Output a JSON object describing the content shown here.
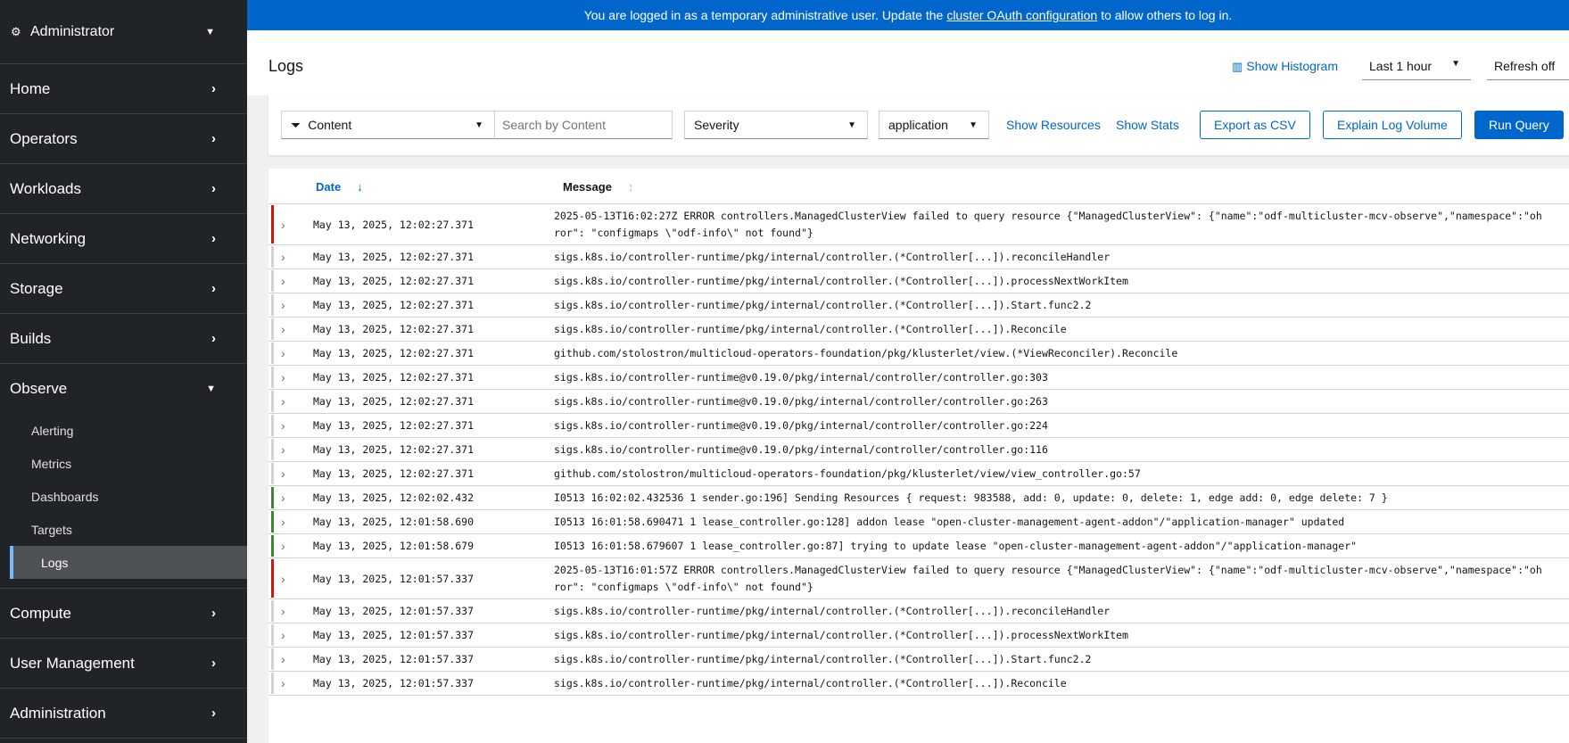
{
  "sidebar": {
    "perspective": "Administrator",
    "items": [
      {
        "label": "Home"
      },
      {
        "label": "Operators"
      },
      {
        "label": "Workloads"
      },
      {
        "label": "Networking"
      },
      {
        "label": "Storage"
      },
      {
        "label": "Builds"
      },
      {
        "label": "Observe"
      },
      {
        "label": "Compute"
      },
      {
        "label": "User Management"
      },
      {
        "label": "Administration"
      }
    ],
    "observe_sub": [
      "Alerting",
      "Metrics",
      "Dashboards",
      "Targets",
      "Logs"
    ]
  },
  "banner": {
    "before": "You are logged in as a temporary administrative user. Update the",
    "link": "cluster OAuth configuration",
    "after": "to allow others to log in."
  },
  "header": {
    "title": "Logs",
    "histogram": "Show Histogram",
    "time_range": "Last 1 hour",
    "refresh": "Refresh off"
  },
  "toolbar": {
    "attribute": "Content",
    "search_placeholder": "Search by Content",
    "severity": "Severity",
    "tenant": "application",
    "show_resources": "Show Resources",
    "show_stats": "Show Stats",
    "export": "Export as CSV",
    "explain": "Explain Log Volume",
    "run": "Run Query"
  },
  "table": {
    "col_date": "Date",
    "col_message": "Message",
    "severity_colors": {
      "error": "#c9190b",
      "info": "#3e8635",
      "none": "#d2d2d2"
    },
    "rows": [
      {
        "date": "May 13, 2025, 12:02:27.371",
        "sev": "error",
        "msg": "2025-05-13T16:02:27Z ERROR controllers.ManagedClusterView failed to query resource {\"ManagedClusterView\": {\"name\":\"odf-multicluster-mcv-observe\",\"namespace\":\"oh\nror\": \"configmaps \\\"odf-info\\\" not found\"}"
      },
      {
        "date": "May 13, 2025, 12:02:27.371",
        "sev": "none",
        "msg": "sigs.k8s.io/controller-runtime/pkg/internal/controller.(*Controller[...]).reconcileHandler"
      },
      {
        "date": "May 13, 2025, 12:02:27.371",
        "sev": "none",
        "msg": "sigs.k8s.io/controller-runtime/pkg/internal/controller.(*Controller[...]).processNextWorkItem"
      },
      {
        "date": "May 13, 2025, 12:02:27.371",
        "sev": "none",
        "msg": "sigs.k8s.io/controller-runtime/pkg/internal/controller.(*Controller[...]).Start.func2.2"
      },
      {
        "date": "May 13, 2025, 12:02:27.371",
        "sev": "none",
        "msg": "sigs.k8s.io/controller-runtime/pkg/internal/controller.(*Controller[...]).Reconcile"
      },
      {
        "date": "May 13, 2025, 12:02:27.371",
        "sev": "none",
        "msg": "github.com/stolostron/multicloud-operators-foundation/pkg/klusterlet/view.(*ViewReconciler).Reconcile"
      },
      {
        "date": "May 13, 2025, 12:02:27.371",
        "sev": "none",
        "msg": "sigs.k8s.io/controller-runtime@v0.19.0/pkg/internal/controller/controller.go:303"
      },
      {
        "date": "May 13, 2025, 12:02:27.371",
        "sev": "none",
        "msg": "sigs.k8s.io/controller-runtime@v0.19.0/pkg/internal/controller/controller.go:263"
      },
      {
        "date": "May 13, 2025, 12:02:27.371",
        "sev": "none",
        "msg": "sigs.k8s.io/controller-runtime@v0.19.0/pkg/internal/controller/controller.go:224"
      },
      {
        "date": "May 13, 2025, 12:02:27.371",
        "sev": "none",
        "msg": "sigs.k8s.io/controller-runtime@v0.19.0/pkg/internal/controller/controller.go:116"
      },
      {
        "date": "May 13, 2025, 12:02:27.371",
        "sev": "none",
        "msg": "github.com/stolostron/multicloud-operators-foundation/pkg/klusterlet/view/view_controller.go:57"
      },
      {
        "date": "May 13, 2025, 12:02:02.432",
        "sev": "info",
        "msg": "I0513 16:02:02.432536 1 sender.go:196] Sending Resources { request: 983588, add: 0, update: 0, delete: 1, edge add: 0, edge delete: 7 }"
      },
      {
        "date": "May 13, 2025, 12:01:58.690",
        "sev": "info",
        "msg": "I0513 16:01:58.690471 1 lease_controller.go:128] addon lease \"open-cluster-management-agent-addon\"/\"application-manager\" updated"
      },
      {
        "date": "May 13, 2025, 12:01:58.679",
        "sev": "info",
        "msg": "I0513 16:01:58.679607 1 lease_controller.go:87] trying to update lease \"open-cluster-management-agent-addon\"/\"application-manager\""
      },
      {
        "date": "May 13, 2025, 12:01:57.337",
        "sev": "error",
        "msg": "2025-05-13T16:01:57Z ERROR controllers.ManagedClusterView failed to query resource {\"ManagedClusterView\": {\"name\":\"odf-multicluster-mcv-observe\",\"namespace\":\"oh\nror\": \"configmaps \\\"odf-info\\\" not found\"}"
      },
      {
        "date": "May 13, 2025, 12:01:57.337",
        "sev": "none",
        "msg": "sigs.k8s.io/controller-runtime/pkg/internal/controller.(*Controller[...]).reconcileHandler"
      },
      {
        "date": "May 13, 2025, 12:01:57.337",
        "sev": "none",
        "msg": "sigs.k8s.io/controller-runtime/pkg/internal/controller.(*Controller[...]).processNextWorkItem"
      },
      {
        "date": "May 13, 2025, 12:01:57.337",
        "sev": "none",
        "msg": "sigs.k8s.io/controller-runtime/pkg/internal/controller.(*Controller[...]).Start.func2.2"
      },
      {
        "date": "May 13, 2025, 12:01:57.337",
        "sev": "none",
        "msg": "sigs.k8s.io/controller-runtime/pkg/internal/controller.(*Controller[...]).Reconcile"
      }
    ]
  }
}
